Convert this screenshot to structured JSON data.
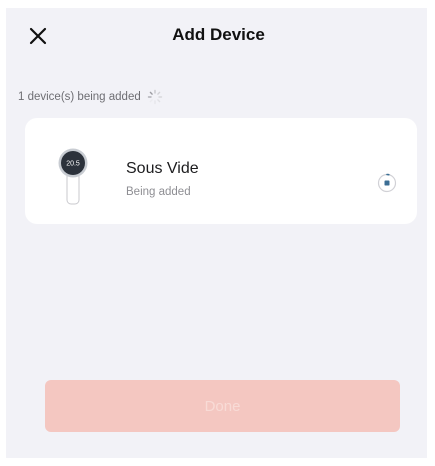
{
  "header": {
    "title": "Add Device",
    "close_icon": "close-icon"
  },
  "status": {
    "text": "1 device(s) being added",
    "icon": "loading-spinner-icon"
  },
  "devices": [
    {
      "name": "Sous Vide",
      "status": "Being added",
      "thumbnail_label": "20.5",
      "icon": "sous-vide-device-icon",
      "progress_icon": "progress-ring-icon"
    }
  ],
  "footer": {
    "done_label": "Done",
    "done_enabled": false
  },
  "colors": {
    "background": "#f2f2f7",
    "card": "#ffffff",
    "button_disabled": "#f4c7c1",
    "progress_accent": "#3b6e94"
  }
}
